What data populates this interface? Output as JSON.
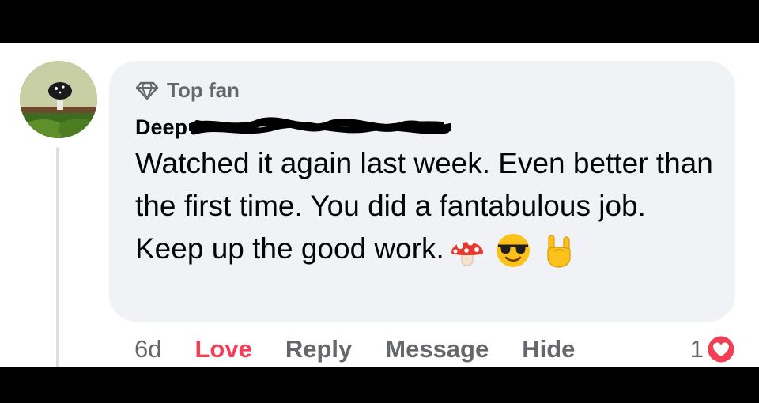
{
  "comment": {
    "badge_label": "Top fan",
    "author_name": "Deep",
    "text": "Watched it again last week. Even better than the first time. You did a fantabulous job. Keep up the good work.",
    "emojis": [
      "mushroom-emoji",
      "sunglasses-emoji",
      "horns-hand-emoji"
    ]
  },
  "actions": {
    "time": "6d",
    "love": "Love",
    "reply": "Reply",
    "message": "Message",
    "hide": "Hide"
  },
  "reactions": {
    "count": "1",
    "icon": "love-reaction-icon"
  },
  "colors": {
    "love": "#f33e58",
    "muted": "#65676b",
    "bubble": "#f0f2f5"
  }
}
